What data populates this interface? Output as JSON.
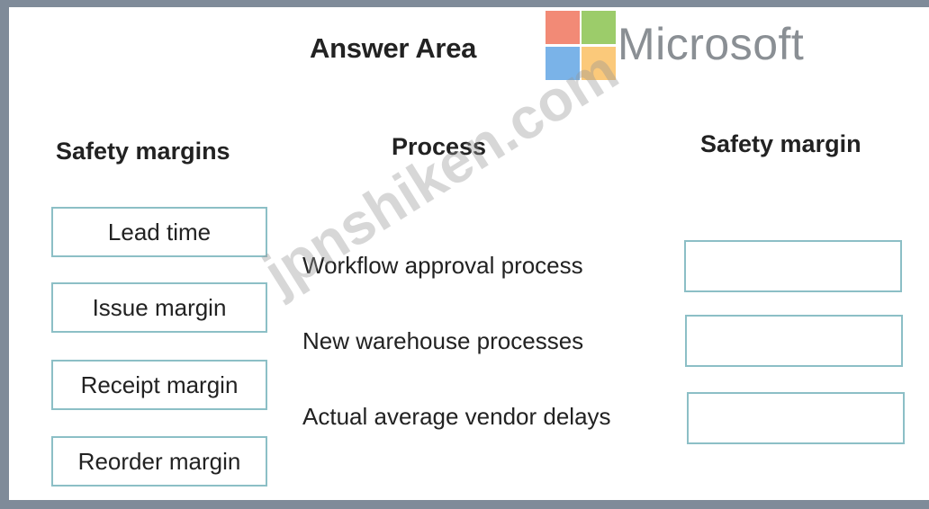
{
  "header": {
    "title": "Answer Area",
    "logo_text": "Microsoft",
    "logo_colors": [
      "#f28a76",
      "#9ccc6a",
      "#7ab3e8",
      "#fbc97a"
    ]
  },
  "columns": {
    "options_heading": "Safety margins",
    "process_heading": "Process",
    "target_heading": "Safety margin"
  },
  "options": [
    "Lead time",
    "Issue margin",
    "Receipt margin",
    "Reorder margin"
  ],
  "processes": [
    "Workflow approval process",
    "New warehouse processes",
    "Actual average vendor delays"
  ],
  "watermark": "jpnshiken.com",
  "colors": {
    "box_border": "#8cbfc6",
    "frame_background": "#7f8b99"
  }
}
